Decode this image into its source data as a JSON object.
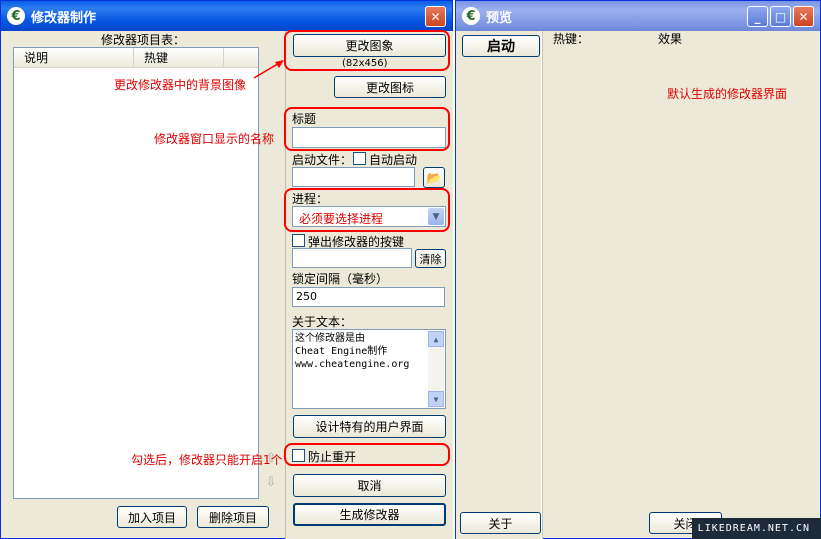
{
  "left_window": {
    "title": "修改器制作",
    "close_label": "✕",
    "list_title": "修改器项目表：",
    "columns": [
      "说明",
      "热键"
    ],
    "add_item": "加入项目",
    "delete_item": "删除项目",
    "change_image": "更改图象",
    "image_size": "(82x456)",
    "change_icon": "更改图标",
    "title_label": "标题",
    "title_value": "",
    "launch_file_label": "启动文件：",
    "auto_launch_label": "自动启动",
    "launch_file_value": "",
    "process_label": "进程：",
    "process_value": "必须要选择进程",
    "popup_hotkey_label": "弹出修改器的按键",
    "popup_hotkey_value": "",
    "clear_label": "清除",
    "lock_interval_label": "锁定间隔（毫秒）",
    "lock_interval_value": "250",
    "about_text_label": "关于文本：",
    "about_text_lines": [
      "这个修改器是由",
      "Cheat Engine制作",
      "www.cheatengine.org"
    ],
    "design_ui": "设计特有的用户界面",
    "prevent_reopen": "防止重开",
    "cancel": "取消",
    "generate": "生成修改器"
  },
  "right_window": {
    "title": "预览",
    "minimize": "_",
    "maximize": "□",
    "close": "✕",
    "start_label": "启动",
    "hotkey_col": "热键：",
    "effect_col": "效果",
    "about": "关于",
    "close_btn": "关闭"
  },
  "annotations": {
    "bg_image": "更改修改器中的背景图像",
    "window_title": "修改器窗口显示的名称",
    "single_instance": "勾选后，修改器只能开启1个",
    "default_ui": "默认生成的修改器界面"
  },
  "watermark": "LIKEDREAM.NET.CN"
}
